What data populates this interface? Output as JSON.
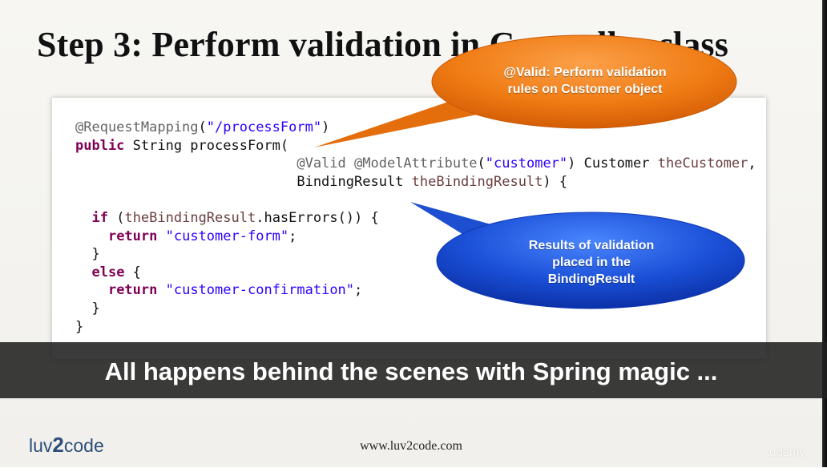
{
  "slide": {
    "title": "Step 3: Perform validation in Controller class"
  },
  "code": {
    "l1_annotation": "@RequestMapping",
    "l1_paren_open": "(",
    "l1_path": "\"/processForm\"",
    "l1_paren_close": ")",
    "l2_kw_public": "public",
    "l2_rest": " String processForm(",
    "l3_indent": "                           ",
    "l3_valid": "@Valid",
    "l3_sp": " ",
    "l3_modelattr": "@ModelAttribute",
    "l3_paren_open": "(",
    "l3_name": "\"customer\"",
    "l3_type": ") Customer ",
    "l3_var": "theCustomer",
    "l3_comma": ",",
    "l4_indent": "                           ",
    "l4_type": "BindingResult ",
    "l4_var": "theBindingResult",
    "l4_end": ") {",
    "l6_indent": "  ",
    "l6_kw_if": "if",
    "l6_paren": " (",
    "l6_var": "theBindingResult",
    "l6_rest": ".hasErrors()) {",
    "l7_indent": "    ",
    "l7_kw_return": "return",
    "l7_sp": " ",
    "l7_str": "\"customer-form\"",
    "l7_end": ";",
    "l8": "  }",
    "l9_indent": "  ",
    "l9_kw_else": "else",
    "l9_end": " {",
    "l10_indent": "    ",
    "l10_kw_return": "return",
    "l10_sp": " ",
    "l10_str": "\"customer-confirmation\"",
    "l10_end": ";",
    "l11": "  }",
    "l12": "}"
  },
  "callouts": {
    "orange_line1": "@Valid: Perform validation",
    "orange_line2": "rules on Customer object",
    "blue_line1": "Results of validation",
    "blue_line2": "placed in the",
    "blue_line3": "BindingResult"
  },
  "caption": "All happens behind the scenes with Spring magic ...",
  "footer": {
    "logo_part1": "luv",
    "logo_part2": "2",
    "logo_part3": "code",
    "url": "www.luv2code.com",
    "watermark": "udemy"
  },
  "colors": {
    "orange_bubble": "#f07c14",
    "blue_bubble": "#1a4fd6",
    "annotation": "#646464",
    "keyword": "#7f0055",
    "string": "#2a00ff",
    "variable": "#6a3e3e",
    "caption_bg": "#202020",
    "logo": "#2c4e79"
  }
}
